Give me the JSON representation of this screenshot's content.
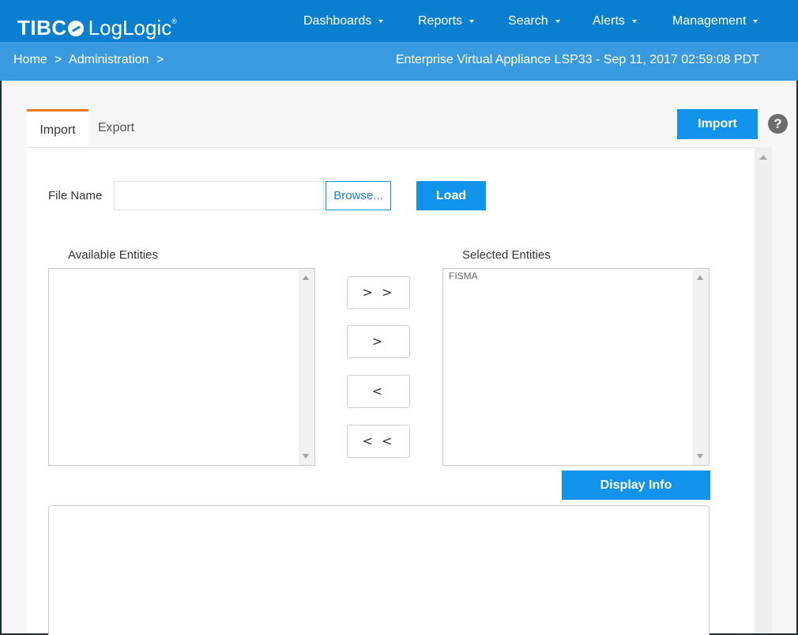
{
  "header": {
    "brand_tibco": "TIBC",
    "brand_product": "LogLogic",
    "brand_mark": "®",
    "nav": [
      {
        "label": "Dashboards"
      },
      {
        "label": "Reports"
      },
      {
        "label": "Search"
      },
      {
        "label": "Alerts"
      },
      {
        "label": "Management"
      }
    ]
  },
  "breadcrumb": {
    "items": [
      "Home",
      ">",
      "Administration",
      ">"
    ],
    "appliance_info": "Enterprise Virtual Appliance LSP33 - Sep 11, 2017 02:59:08 PDT"
  },
  "tabs": [
    {
      "label": "Import",
      "active": true
    },
    {
      "label": "Export",
      "active": false
    }
  ],
  "toolbar": {
    "import_label": "Import",
    "help_label": "?"
  },
  "form": {
    "file_name_label": "File Name",
    "file_name_value": "",
    "browse_label": "Browse...",
    "load_label": "Load"
  },
  "entities": {
    "available_label": "Available Entities",
    "available_items": [],
    "selected_label": "Selected Entities",
    "selected_items": [
      "FISMA"
    ],
    "move_all_right": "> >",
    "move_right": ">",
    "move_left": "<",
    "move_all_left": "< <"
  },
  "display_info_label": "Display Info",
  "colors": {
    "topbar": "#0a7fcf",
    "crumbbar": "#3a9ae0",
    "accent_button": "#1193ec",
    "active_tab": "#f07a1a"
  }
}
